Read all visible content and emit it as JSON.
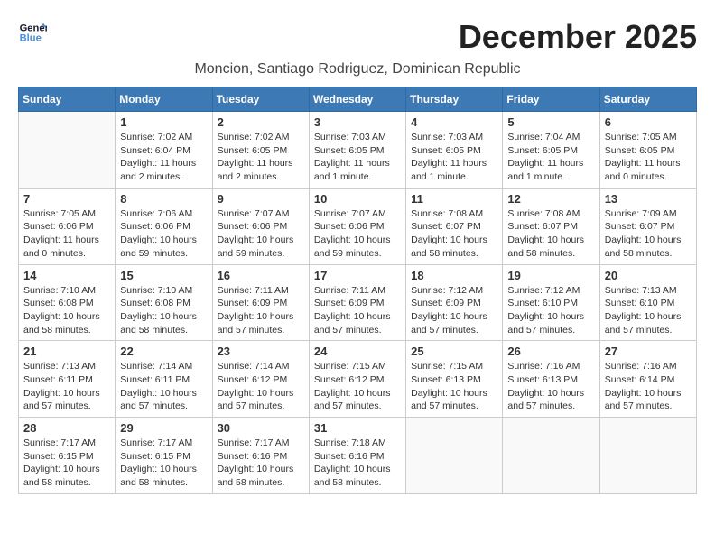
{
  "header": {
    "logo_line1": "General",
    "logo_line2": "Blue",
    "month_year": "December 2025",
    "location": "Moncion, Santiago Rodriguez, Dominican Republic"
  },
  "weekdays": [
    "Sunday",
    "Monday",
    "Tuesday",
    "Wednesday",
    "Thursday",
    "Friday",
    "Saturday"
  ],
  "weeks": [
    [
      {
        "day": "",
        "info": ""
      },
      {
        "day": "1",
        "info": "Sunrise: 7:02 AM\nSunset: 6:04 PM\nDaylight: 11 hours\nand 2 minutes."
      },
      {
        "day": "2",
        "info": "Sunrise: 7:02 AM\nSunset: 6:05 PM\nDaylight: 11 hours\nand 2 minutes."
      },
      {
        "day": "3",
        "info": "Sunrise: 7:03 AM\nSunset: 6:05 PM\nDaylight: 11 hours\nand 1 minute."
      },
      {
        "day": "4",
        "info": "Sunrise: 7:03 AM\nSunset: 6:05 PM\nDaylight: 11 hours\nand 1 minute."
      },
      {
        "day": "5",
        "info": "Sunrise: 7:04 AM\nSunset: 6:05 PM\nDaylight: 11 hours\nand 1 minute."
      },
      {
        "day": "6",
        "info": "Sunrise: 7:05 AM\nSunset: 6:05 PM\nDaylight: 11 hours\nand 0 minutes."
      }
    ],
    [
      {
        "day": "7",
        "info": "Sunrise: 7:05 AM\nSunset: 6:06 PM\nDaylight: 11 hours\nand 0 minutes."
      },
      {
        "day": "8",
        "info": "Sunrise: 7:06 AM\nSunset: 6:06 PM\nDaylight: 10 hours\nand 59 minutes."
      },
      {
        "day": "9",
        "info": "Sunrise: 7:07 AM\nSunset: 6:06 PM\nDaylight: 10 hours\nand 59 minutes."
      },
      {
        "day": "10",
        "info": "Sunrise: 7:07 AM\nSunset: 6:06 PM\nDaylight: 10 hours\nand 59 minutes."
      },
      {
        "day": "11",
        "info": "Sunrise: 7:08 AM\nSunset: 6:07 PM\nDaylight: 10 hours\nand 58 minutes."
      },
      {
        "day": "12",
        "info": "Sunrise: 7:08 AM\nSunset: 6:07 PM\nDaylight: 10 hours\nand 58 minutes."
      },
      {
        "day": "13",
        "info": "Sunrise: 7:09 AM\nSunset: 6:07 PM\nDaylight: 10 hours\nand 58 minutes."
      }
    ],
    [
      {
        "day": "14",
        "info": "Sunrise: 7:10 AM\nSunset: 6:08 PM\nDaylight: 10 hours\nand 58 minutes."
      },
      {
        "day": "15",
        "info": "Sunrise: 7:10 AM\nSunset: 6:08 PM\nDaylight: 10 hours\nand 58 minutes."
      },
      {
        "day": "16",
        "info": "Sunrise: 7:11 AM\nSunset: 6:09 PM\nDaylight: 10 hours\nand 57 minutes."
      },
      {
        "day": "17",
        "info": "Sunrise: 7:11 AM\nSunset: 6:09 PM\nDaylight: 10 hours\nand 57 minutes."
      },
      {
        "day": "18",
        "info": "Sunrise: 7:12 AM\nSunset: 6:09 PM\nDaylight: 10 hours\nand 57 minutes."
      },
      {
        "day": "19",
        "info": "Sunrise: 7:12 AM\nSunset: 6:10 PM\nDaylight: 10 hours\nand 57 minutes."
      },
      {
        "day": "20",
        "info": "Sunrise: 7:13 AM\nSunset: 6:10 PM\nDaylight: 10 hours\nand 57 minutes."
      }
    ],
    [
      {
        "day": "21",
        "info": "Sunrise: 7:13 AM\nSunset: 6:11 PM\nDaylight: 10 hours\nand 57 minutes."
      },
      {
        "day": "22",
        "info": "Sunrise: 7:14 AM\nSunset: 6:11 PM\nDaylight: 10 hours\nand 57 minutes."
      },
      {
        "day": "23",
        "info": "Sunrise: 7:14 AM\nSunset: 6:12 PM\nDaylight: 10 hours\nand 57 minutes."
      },
      {
        "day": "24",
        "info": "Sunrise: 7:15 AM\nSunset: 6:12 PM\nDaylight: 10 hours\nand 57 minutes."
      },
      {
        "day": "25",
        "info": "Sunrise: 7:15 AM\nSunset: 6:13 PM\nDaylight: 10 hours\nand 57 minutes."
      },
      {
        "day": "26",
        "info": "Sunrise: 7:16 AM\nSunset: 6:13 PM\nDaylight: 10 hours\nand 57 minutes."
      },
      {
        "day": "27",
        "info": "Sunrise: 7:16 AM\nSunset: 6:14 PM\nDaylight: 10 hours\nand 57 minutes."
      }
    ],
    [
      {
        "day": "28",
        "info": "Sunrise: 7:17 AM\nSunset: 6:15 PM\nDaylight: 10 hours\nand 58 minutes."
      },
      {
        "day": "29",
        "info": "Sunrise: 7:17 AM\nSunset: 6:15 PM\nDaylight: 10 hours\nand 58 minutes."
      },
      {
        "day": "30",
        "info": "Sunrise: 7:17 AM\nSunset: 6:16 PM\nDaylight: 10 hours\nand 58 minutes."
      },
      {
        "day": "31",
        "info": "Sunrise: 7:18 AM\nSunset: 6:16 PM\nDaylight: 10 hours\nand 58 minutes."
      },
      {
        "day": "",
        "info": ""
      },
      {
        "day": "",
        "info": ""
      },
      {
        "day": "",
        "info": ""
      }
    ]
  ]
}
